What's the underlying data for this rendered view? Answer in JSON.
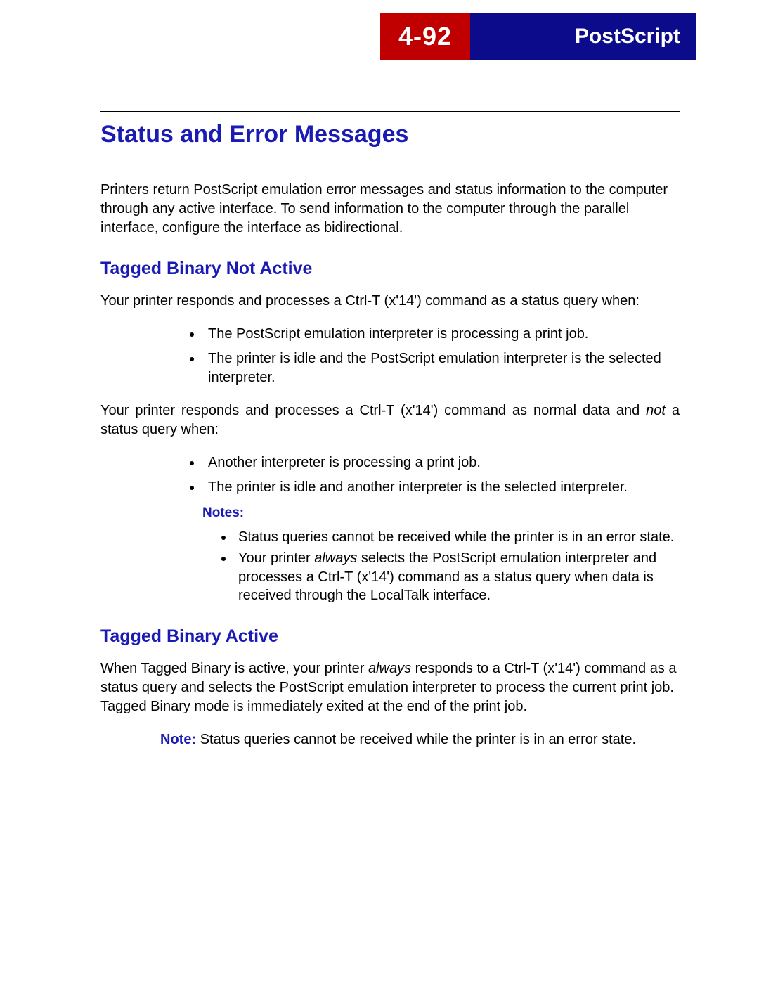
{
  "header": {
    "page_number": "4-92",
    "section": "PostScript"
  },
  "main_heading": "Status and Error Messages",
  "intro": "Printers return PostScript emulation error messages and status information to the computer through any active interface. To send information to the computer through the parallel interface, configure the interface as bidirectional.",
  "tbna": {
    "heading": "Tagged Binary Not Active",
    "p1": "Your printer responds and processes a Ctrl-T (x'14') command as a status query when:",
    "list1": [
      "The PostScript emulation interpreter is processing a print job.",
      "The printer is idle and the PostScript emulation interpreter is the selected interpreter."
    ],
    "p2_a": "Your printer responds and processes a Ctrl-T (x'14') command as normal data and ",
    "p2_it": "not",
    "p2_b": " a status query when:",
    "list2": [
      "Another interpreter is processing a print job.",
      "The printer is idle and another interpreter is the selected interpreter."
    ],
    "notes_label": "Notes:",
    "notes": {
      "n1": "Status queries cannot be received while the printer is in an error state.",
      "n2_a": "Your printer ",
      "n2_it": "always",
      "n2_b": " selects the PostScript emulation interpreter and processes a Ctrl-T (x'14') command as a status query when data is received through the LocalTalk interface."
    }
  },
  "tba": {
    "heading": "Tagged Binary Active",
    "p_a": "When Tagged Binary is active, your printer ",
    "p_it": "always",
    "p_b": " responds to a Ctrl-T (x'14') command as a status query and selects the PostScript emulation interpreter to process the current print job. Tagged Binary mode is immediately exited at the end of the print job.",
    "note_prefix": "Note:",
    "note_rest": "  Status queries cannot be received while the printer is in an error state."
  }
}
